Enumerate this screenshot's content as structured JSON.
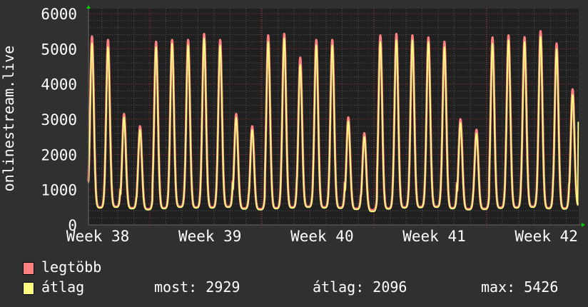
{
  "chart_data": {
    "type": "line",
    "ylabel": "onlinestream.live",
    "ylim": [
      0,
      6000
    ],
    "yticks": [
      0,
      1000,
      2000,
      3000,
      4000,
      5000,
      6000
    ],
    "ytick_labels": [
      "0",
      "1000",
      "2000",
      "3000",
      "4000",
      "5000",
      "6000"
    ],
    "xlim_days": [
      0,
      30.6
    ],
    "xtick_labels": [
      "Week 38",
      "Week 39",
      "Week 40",
      "Week 41",
      "Week 42"
    ],
    "xtick_days": [
      0.27,
      7.27,
      14.27,
      21.27,
      28.27
    ],
    "week_boundaries_days": [
      3.83,
      10.78,
      17.82,
      24.86
    ],
    "grid": true,
    "series": [
      {
        "name": "legtöbb",
        "color": "#ff8080",
        "daily_peaks": [
          5350,
          5250,
          3150,
          2800,
          5200,
          5250,
          5250,
          5420,
          5250,
          3150,
          2800,
          5380,
          5426,
          4750,
          5250,
          5250,
          3050,
          2600,
          5380,
          5420,
          5380,
          5320,
          5200,
          3000,
          2700,
          5320,
          5380,
          5330,
          5500,
          5150,
          3850
        ],
        "daily_min": [
          500,
          520,
          480,
          450,
          480,
          520,
          500,
          500,
          520,
          470,
          450,
          480,
          500,
          520,
          500,
          490,
          460,
          420,
          470,
          500,
          510,
          520,
          480,
          450,
          460,
          490,
          500,
          520,
          480,
          470,
          520
        ]
      },
      {
        "name": "átlag",
        "color": "#ffff80",
        "daily_peaks": [
          5150,
          5050,
          3050,
          2700,
          5050,
          5150,
          5100,
          5300,
          5100,
          3050,
          2700,
          5200,
          5300,
          4550,
          5100,
          5100,
          2950,
          2500,
          5200,
          5250,
          5250,
          5200,
          5050,
          2900,
          2600,
          5150,
          5250,
          5200,
          5350,
          5000,
          3700
        ],
        "daily_min": [
          480,
          500,
          460,
          430,
          460,
          500,
          480,
          480,
          500,
          450,
          430,
          460,
          480,
          500,
          480,
          470,
          440,
          380,
          450,
          480,
          490,
          500,
          460,
          430,
          440,
          470,
          480,
          500,
          460,
          450,
          500
        ],
        "now": 2929
      }
    ],
    "legend": {
      "max_label": "legtöbb",
      "avg_label": "átlag",
      "stats": {
        "most": "most: 2929",
        "atlag": "átlag: 2096",
        "max": "max: 5426"
      }
    }
  },
  "colors": {
    "background": "#303030",
    "plot": "#202020",
    "grid": "#555555",
    "major_grid": "#a03030",
    "axis_arrow": "#00cc00"
  }
}
